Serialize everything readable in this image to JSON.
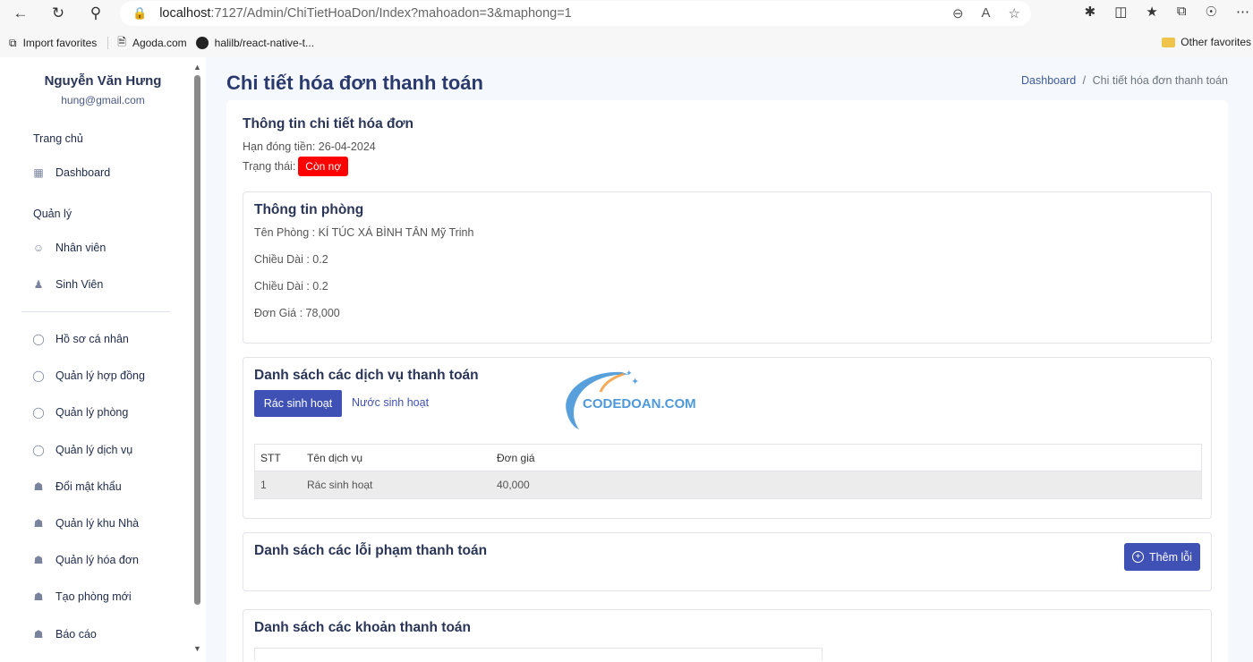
{
  "browser": {
    "url_host": "localhost",
    "url_path": ":7127/Admin/ChiTietHoaDon/Index?mahoadon=3&maphong=1",
    "bookmarks": [
      "Import favorites",
      "Agoda.com",
      "halilb/react-native-t..."
    ],
    "other_favorites": "Other favorites"
  },
  "sidebar": {
    "user_name": "Nguyễn Văn Hưng",
    "user_email": "hung@gmail.com",
    "section_home": "Trang chủ",
    "dashboard": "Dashboard",
    "section_manage": "Quản lý",
    "staff": "Nhân viên",
    "students": "Sinh Viên",
    "items": [
      {
        "label": "Hồ sơ cá nhân",
        "icon": "user-icon"
      },
      {
        "label": "Quản lý hợp đồng",
        "icon": "user-icon"
      },
      {
        "label": "Quản lý phòng",
        "icon": "user-icon"
      },
      {
        "label": "Quản lý dịch vụ",
        "icon": "user-icon"
      },
      {
        "label": "Đổi mật khẩu",
        "icon": "lock-icon"
      },
      {
        "label": "Quản lý khu Nhà",
        "icon": "lock-icon"
      },
      {
        "label": "Quản lý hóa đơn",
        "icon": "lock-icon"
      },
      {
        "label": "Tạo phòng mới",
        "icon": "lock-icon"
      },
      {
        "label": "Báo cáo",
        "icon": "lock-icon"
      }
    ]
  },
  "page": {
    "title": "Chi tiết hóa đơn thanh toán",
    "breadcrumb_home": "Dashboard",
    "breadcrumb_sep": "/",
    "breadcrumb_current": "Chi tiết hóa đơn thanh toán"
  },
  "invoice": {
    "heading": "Thông tin chi tiết hóa đơn",
    "due_label": "Hạn đóng tiền: 26-04-2024",
    "status_label": "Trạng thái:",
    "status_badge": "Còn nợ",
    "status_color": "#ff0000"
  },
  "room": {
    "heading": "Thông tin phòng",
    "name_line": "Tên Phòng : KÍ TÚC XÁ BÌNH TÂN Mỹ Trinh",
    "length_line": "Chiều Dài : 0.2",
    "width_line": "Chiều Dài : 0.2",
    "price_line": "Đơn Giá : 78,000"
  },
  "services": {
    "heading": "Danh sách các dịch vụ thanh toán",
    "tab_active": "Rác sinh hoạt",
    "tab_other": "Nước sinh hoạt",
    "columns": [
      "STT",
      "Tên dịch vụ",
      "Đơn giá"
    ],
    "rows": [
      {
        "stt": "1",
        "name": "Rác sinh hoạt",
        "price": "40,000"
      }
    ]
  },
  "violations": {
    "heading": "Danh sách các lỗi phạm thanh toán",
    "add_button": "Thêm lỗi"
  },
  "payments": {
    "heading": "Danh sách các khoản thanh toán"
  },
  "watermark": {
    "text": "CODEDOAN.COM"
  },
  "accent_color": "#3f51b5"
}
